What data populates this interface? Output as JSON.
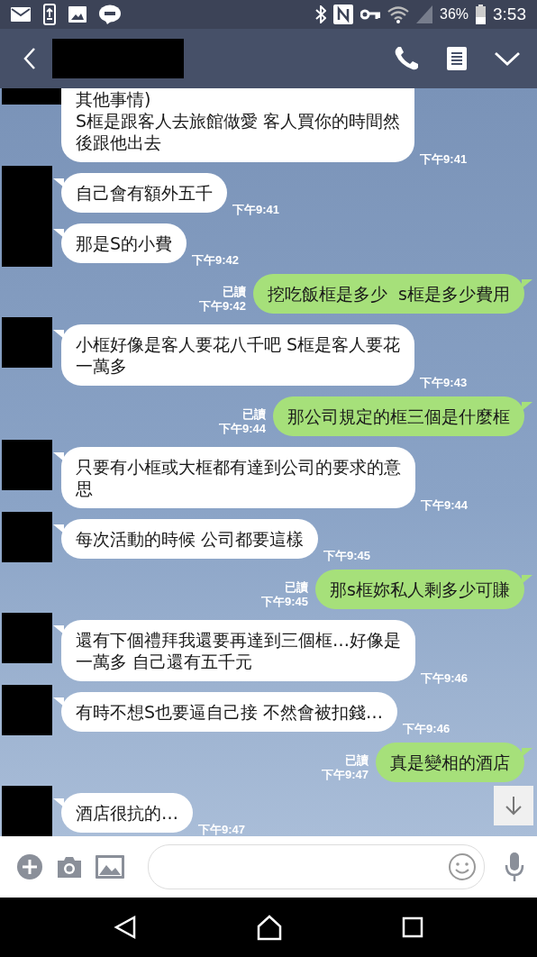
{
  "status_bar": {
    "battery": "36%",
    "time": "3:53"
  },
  "messages": [
    {
      "kind": "received",
      "lines": [
        "其他事情)",
        "S框是跟客人去旅館做愛 客人買你的時間然",
        "後跟他出去"
      ],
      "time": "下午9:41"
    },
    {
      "kind": "received",
      "lines": [
        "自己會有額外五千"
      ],
      "time": "下午9:41"
    },
    {
      "kind": "received",
      "lines": [
        "那是S的小費"
      ],
      "time": "下午9:42"
    },
    {
      "kind": "sent",
      "lines": [
        "挖吃飯框是多少  s框是多少費用"
      ],
      "read": "已讀",
      "time": "下午9:42"
    },
    {
      "kind": "received",
      "lines": [
        "小框好像是客人要花八千吧 S框是客人要花",
        "一萬多"
      ],
      "time": "下午9:43"
    },
    {
      "kind": "sent",
      "lines": [
        "那公司規定的框三個是什麼框"
      ],
      "read": "已讀",
      "time": "下午9:44"
    },
    {
      "kind": "received",
      "lines": [
        "只要有小框或大框都有達到公司的要求的意",
        "思"
      ],
      "time": "下午9:44"
    },
    {
      "kind": "received",
      "lines": [
        "每次活動的時候 公司都要這樣"
      ],
      "time": "下午9:45"
    },
    {
      "kind": "sent",
      "lines": [
        "那s框妳私人剩多少可賺"
      ],
      "read": "已讀",
      "time": "下午9:45"
    },
    {
      "kind": "received",
      "lines": [
        "還有下個禮拜我還要再達到三個框…好像是",
        "一萬多 自己還有五千元"
      ],
      "time": "下午9:46"
    },
    {
      "kind": "received",
      "lines": [
        "有時不想S也要逼自己接 不然會被扣錢…"
      ],
      "time": "下午9:46"
    },
    {
      "kind": "sent",
      "lines": [
        "真是變相的酒店"
      ],
      "read": "已讀",
      "time": "下午9:47"
    },
    {
      "kind": "received",
      "lines": [
        "酒店很抗的…"
      ],
      "time": "下午9:47"
    }
  ]
}
